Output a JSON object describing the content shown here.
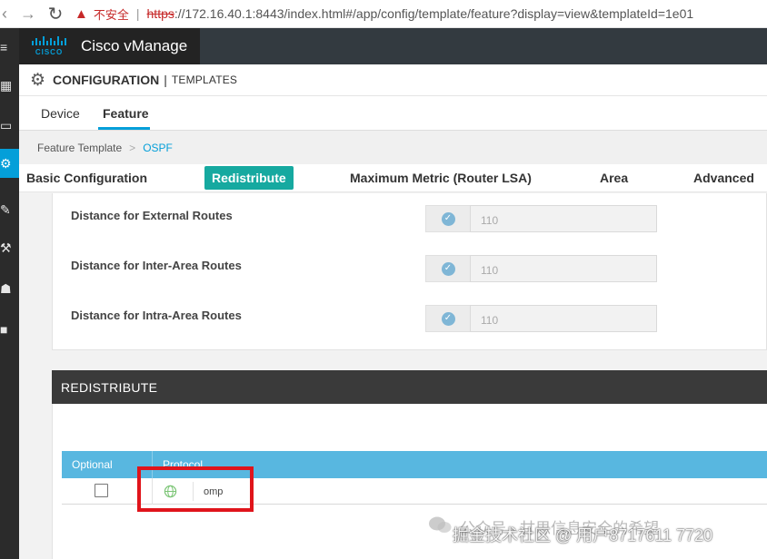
{
  "browser": {
    "insecure_label": "不安全",
    "url_scheme": "https",
    "url_rest": "://172.16.40.1:8443/index.html#/app/config/template/feature?display=view&templateId=1e01"
  },
  "header": {
    "logo_text": "CISCO",
    "app_title": "Cisco vManage"
  },
  "config_bar": {
    "title": "CONFIGURATION",
    "separator": "|",
    "subtitle": "TEMPLATES"
  },
  "tabs": {
    "device": "Device",
    "feature": "Feature"
  },
  "breadcrumb": {
    "root": "Feature Template",
    "separator": ">",
    "current": "OSPF"
  },
  "section_tabs": {
    "basic": "Basic Configuration",
    "redistribute": "Redistribute",
    "max_metric": "Maximum Metric (Router LSA)",
    "area": "Area",
    "advanced": "Advanced"
  },
  "distance": {
    "rows": [
      {
        "label": "Distance for External Routes",
        "value": "110"
      },
      {
        "label": "Distance for Inter-Area Routes",
        "value": "110"
      },
      {
        "label": "Distance for Intra-Area Routes",
        "value": "110"
      }
    ]
  },
  "redistribute": {
    "title": "REDISTRIBUTE",
    "columns": {
      "optional": "Optional",
      "protocol": "Protocol"
    },
    "rows": [
      {
        "optional": false,
        "protocol": "omp"
      }
    ]
  },
  "watermark": {
    "line1": "公众号 · 甘思信息安全的希望",
    "line2": "掘金技术社区 @ 用户8717611 7720"
  },
  "colors": {
    "accent": "#049fd9",
    "active_tab": "#16a9a0",
    "highlight": "#e0141b"
  }
}
